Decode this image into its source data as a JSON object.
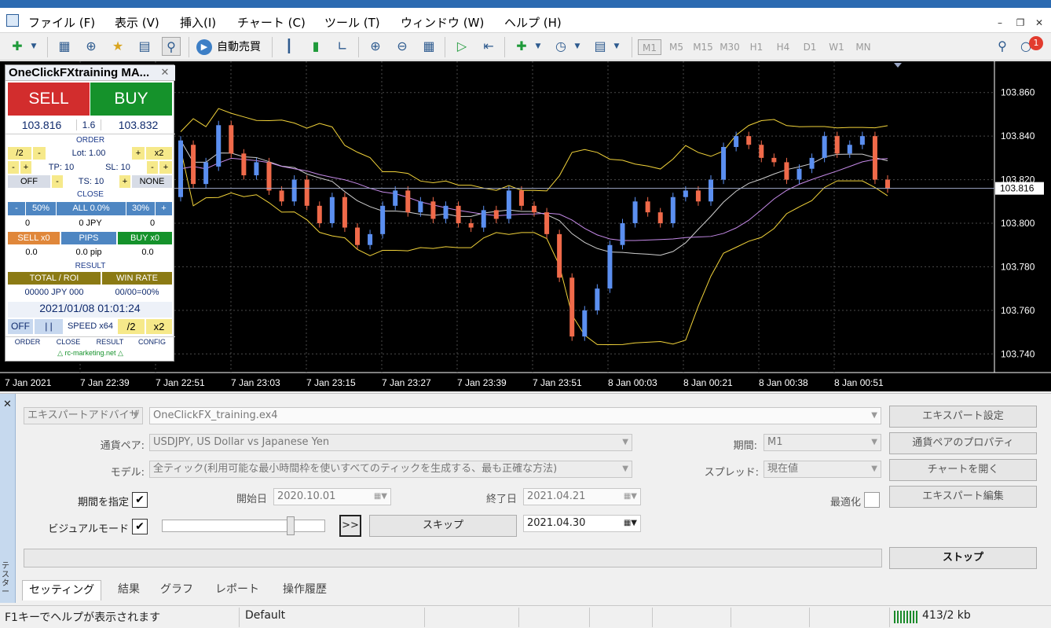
{
  "menu": {
    "items": [
      "ファイル (F)",
      "表示 (V)",
      "挿入(I)",
      "チャート (C)",
      "ツール (T)",
      "ウィンドウ (W)",
      "ヘルプ (H)"
    ]
  },
  "toolbar": {
    "auto_trade_label": "自動売買",
    "timeframes": [
      "M1",
      "M5",
      "M15",
      "M30",
      "H1",
      "H4",
      "D1",
      "W1",
      "MN"
    ],
    "active_timeframe": "M1",
    "notification_count": "1"
  },
  "chart": {
    "current_price": "103.816",
    "y_ticks": [
      "103.860",
      "103.840",
      "103.820",
      "103.800",
      "103.780",
      "103.760",
      "103.740"
    ],
    "x_ticks": [
      "7 Jan 2021",
      "7 Jan 22:39",
      "7 Jan 22:51",
      "7 Jan 23:03",
      "7 Jan 23:15",
      "7 Jan 23:27",
      "7 Jan 23:39",
      "7 Jan 23:51",
      "8 Jan 00:03",
      "8 Jan 00:21",
      "8 Jan 00:38",
      "8 Jan 00:51"
    ],
    "colors": {
      "bull": "#5b8ff0",
      "bear": "#f06a4a",
      "bands": "#f2d33a",
      "ma": "#c58ae8",
      "bid_line": "#9fa8c8"
    }
  },
  "chart_data": {
    "type": "candlestick",
    "ylim": [
      103.73,
      103.87
    ],
    "candles": [
      [
        103.812,
        103.838
      ],
      [
        103.836,
        103.818
      ],
      [
        103.818,
        103.828
      ],
      [
        103.826,
        103.845
      ],
      [
        103.845,
        103.832
      ],
      [
        103.832,
        103.822
      ],
      [
        103.822,
        103.828
      ],
      [
        103.828,
        103.815
      ],
      [
        103.815,
        103.81
      ],
      [
        103.81,
        103.82
      ],
      [
        103.82,
        103.808
      ],
      [
        103.808,
        103.8
      ],
      [
        103.8,
        103.812
      ],
      [
        103.812,
        103.798
      ],
      [
        103.798,
        103.79
      ],
      [
        103.79,
        103.795
      ],
      [
        103.795,
        103.808
      ],
      [
        103.808,
        103.815
      ],
      [
        103.815,
        103.805
      ],
      [
        103.805,
        103.81
      ],
      [
        103.81,
        103.802
      ],
      [
        103.802,
        103.808
      ],
      [
        103.808,
        103.8
      ],
      [
        103.8,
        103.798
      ],
      [
        103.798,
        103.806
      ],
      [
        103.806,
        103.802
      ],
      [
        103.802,
        103.815
      ],
      [
        103.815,
        103.808
      ],
      [
        103.808,
        103.805
      ],
      [
        103.805,
        103.795
      ],
      [
        103.795,
        103.775
      ],
      [
        103.775,
        103.748
      ],
      [
        103.748,
        103.76
      ],
      [
        103.76,
        103.77
      ],
      [
        103.77,
        103.79
      ],
      [
        103.79,
        103.8
      ],
      [
        103.8,
        103.81
      ],
      [
        103.81,
        103.805
      ],
      [
        103.805,
        103.8
      ],
      [
        103.8,
        103.812
      ],
      [
        103.812,
        103.815
      ],
      [
        103.815,
        103.81
      ],
      [
        103.81,
        103.82
      ],
      [
        103.82,
        103.835
      ],
      [
        103.835,
        103.84
      ],
      [
        103.84,
        103.836
      ],
      [
        103.836,
        103.83
      ],
      [
        103.83,
        103.828
      ],
      [
        103.828,
        103.82
      ],
      [
        103.82,
        103.825
      ],
      [
        103.825,
        103.83
      ],
      [
        103.83,
        103.84
      ],
      [
        103.84,
        103.832
      ],
      [
        103.832,
        103.836
      ],
      [
        103.836,
        103.84
      ],
      [
        103.84,
        103.82
      ],
      [
        103.82,
        103.816
      ]
    ]
  },
  "panel": {
    "title": "OneClickFXtraining MA...",
    "sell": "SELL",
    "buy": "BUY",
    "bid": "103.816",
    "spread": "1.6",
    "ask": "103.832",
    "order_header": "ORDER",
    "half": "/2",
    "minus": "-",
    "plus": "+",
    "lot": "Lot: 1.00",
    "double": "x2",
    "tp": "TP: 10",
    "sl": "SL: 10",
    "off": "OFF",
    "ts": "TS: 10",
    "none": "NONE",
    "close_header": "CLOSE",
    "pct50": "50%",
    "all": "ALL 0.0%",
    "pct30": "30%",
    "count_left": "0",
    "jpy": "0 JPY",
    "count_right": "0",
    "sell_x0": "SELL x0",
    "pips": "PIPS",
    "buy_x0": "BUY x0",
    "val_left": "0.0",
    "pip_val": "0.0 pip",
    "val_right": "0.0",
    "result_header": "RESULT",
    "total_roi": "TOTAL / ROI",
    "win_rate": "WIN RATE",
    "roi_value": "00000 JPY 000",
    "win_value": "00/00=00%",
    "datetime": "2021/01/08  01:01:24",
    "off2": "OFF",
    "pause": "| |",
    "speed": "SPEED x64",
    "half2": "/2",
    "double2": "x2",
    "nav": [
      "ORDER",
      "CLOSE",
      "RESULT",
      "CONFIG"
    ],
    "footer": "△ rc-marketing.net △"
  },
  "tester": {
    "side_label": "テスター",
    "type_value": "エキスパートアドバイザ",
    "expert_value": "OneClickFX_training.ex4",
    "symbol_label": "通貨ペア:",
    "symbol_value": "USDJPY, US Dollar vs Japanese Yen",
    "model_label": "モデル:",
    "model_value": "全ティック(利用可能な最小時間枠を使いすべてのティックを生成する、最も正確な方法)",
    "period_label": "期間:",
    "period_value": "M1",
    "spread_label": "スプレッド:",
    "spread_value": "現在値",
    "use_date_label": "期間を指定",
    "start_label": "開始日",
    "start_value": "2020.10.01",
    "end_label": "終了日",
    "end_value": "2021.04.21",
    "optimize_label": "最適化",
    "visual_label": "ビジュアルモード",
    "fast_forward": ">>",
    "skip": "スキップ",
    "skip_to": "2021.04.30",
    "btn_expert_settings": "エキスパート設定",
    "btn_symbol_props": "通貨ペアのプロパティ",
    "btn_open_chart": "チャートを開く",
    "btn_edit_expert": "エキスパート編集",
    "btn_stop": "ストップ",
    "tabs": [
      "セッティング",
      "結果",
      "グラフ",
      "レポート",
      "操作履歴"
    ]
  },
  "status": {
    "help": "F1キーでヘルプが表示されます",
    "profile": "Default",
    "traffic": "413/2 kb"
  }
}
